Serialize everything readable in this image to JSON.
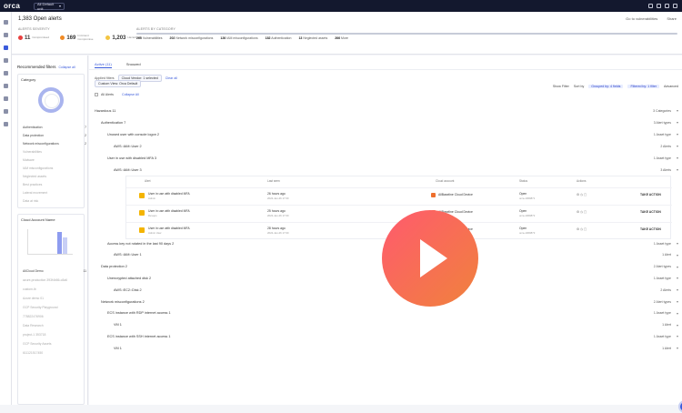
{
  "app": {
    "logo": "orca",
    "tenant": "All Default unit"
  },
  "header": {
    "title": "1,383 Open alerts",
    "links": [
      "Go to vulnerabilities",
      "Share"
    ],
    "severity_title": "ALERTS SEVERITY",
    "severity": [
      {
        "value": "11",
        "label": "Compromised",
        "color": "#e8403f"
      },
      {
        "value": "169",
        "label": "Imminent Compromise",
        "color": "#f08a24"
      },
      {
        "value": "1,203",
        "label": "Hazardous",
        "color": "#f3c542"
      }
    ],
    "category_title": "ALERTS BY CATEGORY",
    "categories": [
      {
        "value": "265",
        "label": "Vulnerabilities"
      },
      {
        "value": "202",
        "label": "Network misconfigurations"
      },
      {
        "value": "126",
        "label": "IAM misconfigurations"
      },
      {
        "value": "182",
        "label": "Authentication"
      },
      {
        "value": "13",
        "label": "Neglected assets"
      },
      {
        "value": "266",
        "label": "More"
      }
    ]
  },
  "left": {
    "title": "Recommended filters",
    "collapse": "Collapse all",
    "category_title": "Category",
    "category_items": [
      {
        "label": "Authentication",
        "count": "7"
      },
      {
        "label": "Data protection",
        "count": "2"
      },
      {
        "label": "Network misconfigurations",
        "count": "2"
      },
      {
        "label": "Vulnerabilities",
        "count": ""
      },
      {
        "label": "Malware",
        "count": ""
      },
      {
        "label": "IAM misconfigurations",
        "count": ""
      },
      {
        "label": "Neglected assets",
        "count": ""
      },
      {
        "label": "Best practices",
        "count": ""
      },
      {
        "label": "Lateral movement",
        "count": ""
      },
      {
        "label": "Data at risk",
        "count": ""
      }
    ],
    "cloud_title": "Cloud Account Name",
    "cloud_items": [
      {
        "label": "AllCloud Demo",
        "count": "11"
      },
      {
        "label": "azure-production 393f4b86-c8a6",
        "count": ""
      },
      {
        "label": "custom-lb",
        "count": ""
      },
      {
        "label": "Azure demo 01",
        "count": ""
      },
      {
        "label": "GCP Security Playground",
        "count": ""
      },
      {
        "label": "778822476906",
        "count": ""
      },
      {
        "label": "Data Research",
        "count": ""
      },
      {
        "label": "project-1 353718",
        "count": ""
      },
      {
        "label": "GCP Security Assets",
        "count": ""
      },
      {
        "label": "611121517450",
        "count": ""
      }
    ]
  },
  "tabs": [
    "Active (11)",
    "Snoozed"
  ],
  "filters": {
    "applied": "Applied filters",
    "chip": "Cloud Vendor: 1 selected",
    "clear": "Clear all",
    "view": "Custom View: Orca Default"
  },
  "controls": {
    "all_alerts": "All Alerts",
    "collapse_all": "Collapse All",
    "right": [
      "Show Filter",
      "Sort by",
      "Grouped by: 4 fields",
      "Filtered by: 1 filter",
      "Advanced"
    ]
  },
  "groups": [
    {
      "indent": 0,
      "label": "Hazardous 11",
      "right": "3 Categories"
    },
    {
      "indent": 1,
      "label": "Authentication 7",
      "right": "3 Alert types"
    },
    {
      "indent": 2,
      "label": "Unused user with console logon 2",
      "right": "1 Asset type"
    },
    {
      "indent": 3,
      "label": "AWS::IAM::User 2",
      "right": "2 Alerts"
    },
    {
      "indent": 2,
      "label": "User in use with disabled MFA 3",
      "right": "1 Asset type"
    },
    {
      "indent": 3,
      "label": "AWS::IAM::User 3",
      "right": "3 Alerts"
    }
  ],
  "table": {
    "headers": [
      "Alert",
      "Last seen",
      "",
      "Cloud account",
      "Status",
      "Actions"
    ],
    "rows": [
      {
        "alert": "User in use with disabled MFA",
        "asset": "Admin",
        "seen": "26 hours ago",
        "date": "2022-Jan-26 17:00",
        "account": "AllBaseline Cloud Device",
        "status": "Open",
        "id": "orca-1069871",
        "action": "TAKE ACTION"
      },
      {
        "alert": "User in use with disabled MFA",
        "asset": "Devops",
        "seen": "25 hours ago",
        "date": "2022-Jan-26 17:00",
        "account": "AllBaseline Cloud Device",
        "status": "Open",
        "id": "orca-1069872",
        "action": "TAKE ACTION"
      },
      {
        "alert": "User in use with disabled MFA",
        "asset": "Admin User",
        "seen": "28 hours ago",
        "date": "2022-Jan-26 17:00",
        "account": "AllBaseline Cloud Device",
        "status": "Open",
        "id": "orca-1069873",
        "action": "TAKE ACTION"
      }
    ]
  },
  "groups2": [
    {
      "indent": 2,
      "label": "Access key not rotated in the last 90 days 2",
      "right": "1 Asset type"
    },
    {
      "indent": 3,
      "label": "AWS::IAM::User 1",
      "right": "1 Alert"
    },
    {
      "indent": 1,
      "label": "Data protection 2",
      "right": "2 Alert types"
    },
    {
      "indent": 2,
      "label": "Unencrypted attached disk 2",
      "right": "1 Asset type"
    },
    {
      "indent": 3,
      "label": "AWS::EC2::Disk 2",
      "right": "2 Alerts"
    },
    {
      "indent": 1,
      "label": "Network misconfigurations 2",
      "right": "2 Alert types"
    },
    {
      "indent": 2,
      "label": "ECS instance with RDP internet access 1",
      "right": "1 Asset type"
    },
    {
      "indent": 3,
      "label": "VM 1",
      "right": "1 Alert"
    },
    {
      "indent": 2,
      "label": "ECS instance with SSH internet access 1",
      "right": "1 Asset type"
    },
    {
      "indent": 3,
      "label": "VM 1",
      "right": "1 Alert"
    }
  ]
}
